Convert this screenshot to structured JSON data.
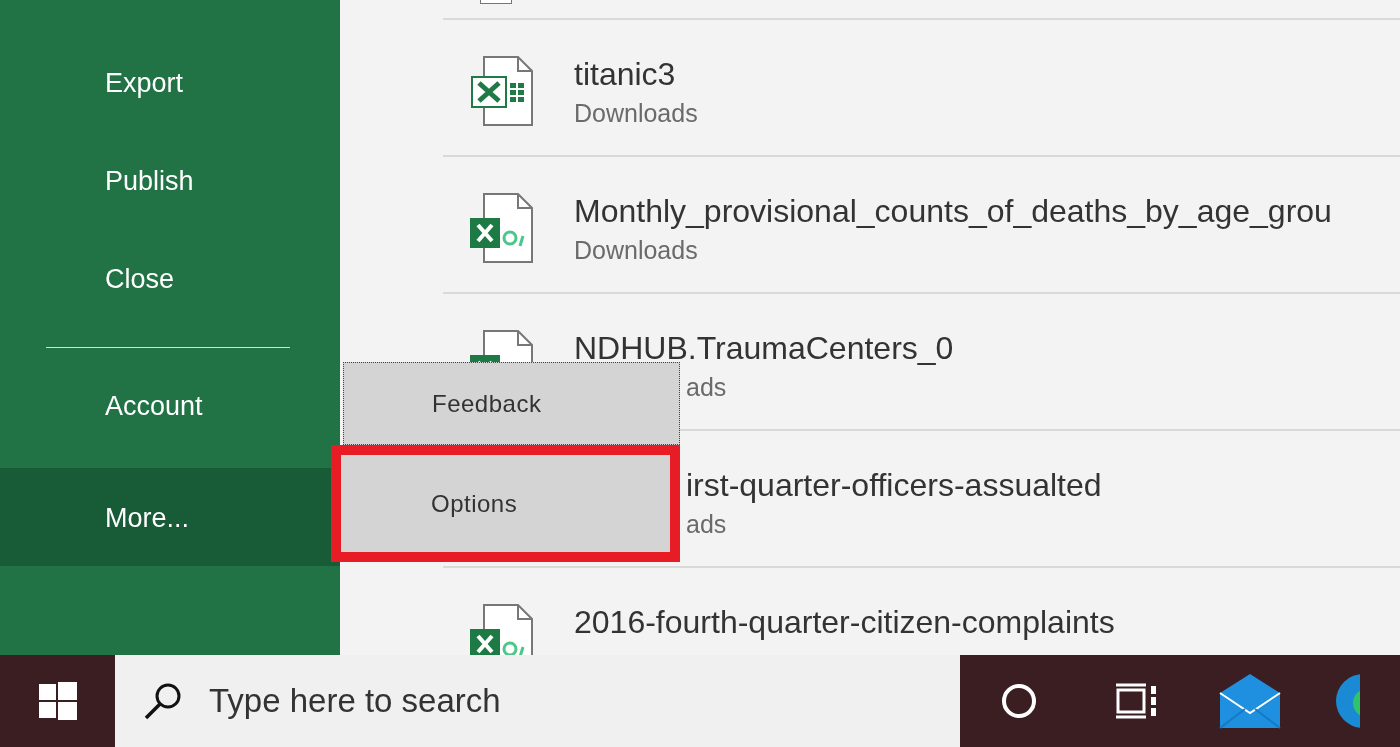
{
  "sidebar": {
    "items": [
      {
        "label": "Export",
        "selected": false
      },
      {
        "label": "Publish",
        "selected": false
      },
      {
        "label": "Close",
        "selected": false
      },
      {
        "kind": "divider"
      },
      {
        "label": "Account",
        "selected": false
      },
      {
        "label": "More...",
        "selected": true
      }
    ]
  },
  "files": [
    {
      "kind": "file",
      "title": "titanic3",
      "location": "Downloads"
    },
    {
      "kind": "file",
      "title": "Monthly_provisional_counts_of_deaths_by_age_grou",
      "location": "Downloads"
    },
    {
      "kind": "location-cut",
      "title": "NDHUB.TraumaCenters_0",
      "location": "ads"
    },
    {
      "kind": "all-cut",
      "title": "irst-quarter-officers-assualted",
      "location": "ads"
    },
    {
      "kind": "file",
      "title": "2016-fourth-quarter-citizen-complaints"
    }
  ],
  "more_menu": [
    {
      "label": "Feedback",
      "highlighted": false
    },
    {
      "label": "Options",
      "highlighted": true
    }
  ],
  "taskbar": {
    "search": {
      "placeholder": "Type here to search"
    }
  }
}
